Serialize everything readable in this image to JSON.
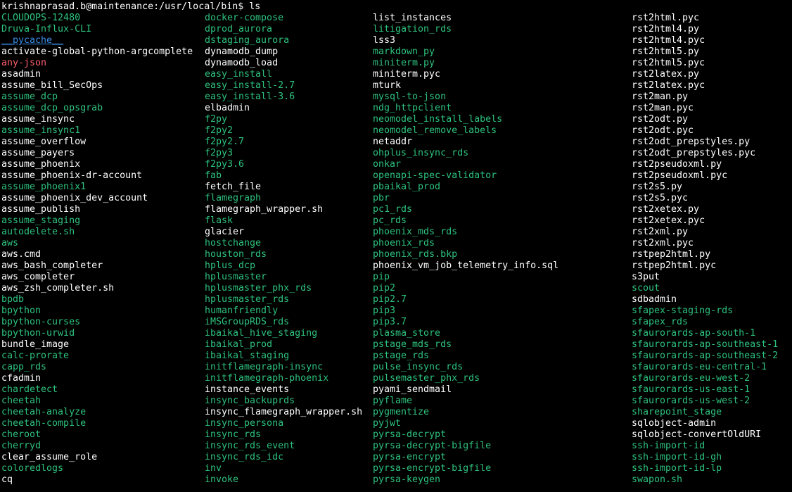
{
  "terminal": {
    "prompt": "krishnaprasad.b@maintenance:/usr/local/bin$ ",
    "command": "ls",
    "colors": {
      "background": "#000000",
      "executable": "#2ec27e",
      "directory": "#3b8eea",
      "regular": "#ffffff",
      "broken_link": "#ff5f6d"
    },
    "columns": [
      [
        {
          "name": "CLOUDOPS-12480",
          "type": "exec"
        },
        {
          "name": "Druva-Influx-CLI",
          "type": "exec"
        },
        {
          "name": "__pycache__",
          "type": "dir"
        },
        {
          "name": "activate-global-python-argcomplete",
          "type": "file"
        },
        {
          "name": "any-json",
          "type": "link"
        },
        {
          "name": "asadmin",
          "type": "file"
        },
        {
          "name": "assume_bill_SecOps",
          "type": "file"
        },
        {
          "name": "assume_dcp",
          "type": "exec"
        },
        {
          "name": "assume_dcp_opsgrab",
          "type": "exec"
        },
        {
          "name": "assume_insync",
          "type": "file"
        },
        {
          "name": "assume_insync1",
          "type": "exec"
        },
        {
          "name": "assume_overflow",
          "type": "file"
        },
        {
          "name": "assume_payers",
          "type": "file"
        },
        {
          "name": "assume_phoenix",
          "type": "file"
        },
        {
          "name": "assume_phoenix-dr-account",
          "type": "file"
        },
        {
          "name": "assume_phoenix1",
          "type": "exec"
        },
        {
          "name": "assume_phoenix_dev_account",
          "type": "file"
        },
        {
          "name": "assume_publish",
          "type": "file"
        },
        {
          "name": "assume_staging",
          "type": "exec"
        },
        {
          "name": "autodelete.sh",
          "type": "exec"
        },
        {
          "name": "aws",
          "type": "exec"
        },
        {
          "name": "aws.cmd",
          "type": "file"
        },
        {
          "name": "aws_bash_completer",
          "type": "file"
        },
        {
          "name": "aws_completer",
          "type": "file"
        },
        {
          "name": "aws_zsh_completer.sh",
          "type": "file"
        },
        {
          "name": "bpdb",
          "type": "exec"
        },
        {
          "name": "bpython",
          "type": "exec"
        },
        {
          "name": "bpython-curses",
          "type": "exec"
        },
        {
          "name": "bpython-urwid",
          "type": "exec"
        },
        {
          "name": "bundle_image",
          "type": "file"
        },
        {
          "name": "calc-prorate",
          "type": "exec"
        },
        {
          "name": "capp_rds",
          "type": "exec"
        },
        {
          "name": "cfadmin",
          "type": "file"
        },
        {
          "name": "chardetect",
          "type": "exec"
        },
        {
          "name": "cheetah",
          "type": "exec"
        },
        {
          "name": "cheetah-analyze",
          "type": "exec"
        },
        {
          "name": "cheetah-compile",
          "type": "exec"
        },
        {
          "name": "cheroot",
          "type": "exec"
        },
        {
          "name": "cherryd",
          "type": "exec"
        },
        {
          "name": "clear_assume_role",
          "type": "file"
        },
        {
          "name": "coloredlogs",
          "type": "exec"
        },
        {
          "name": "cq",
          "type": "file"
        }
      ],
      [
        {
          "name": "docker-compose",
          "type": "exec"
        },
        {
          "name": "dprod_aurora",
          "type": "exec"
        },
        {
          "name": "dstaging_aurora",
          "type": "exec"
        },
        {
          "name": "dynamodb_dump",
          "type": "file"
        },
        {
          "name": "dynamodb_load",
          "type": "file"
        },
        {
          "name": "easy_install",
          "type": "exec"
        },
        {
          "name": "easy_install-2.7",
          "type": "exec"
        },
        {
          "name": "easy_install-3.6",
          "type": "exec"
        },
        {
          "name": "elbadmin",
          "type": "file"
        },
        {
          "name": "f2py",
          "type": "exec"
        },
        {
          "name": "f2py2",
          "type": "exec"
        },
        {
          "name": "f2py2.7",
          "type": "exec"
        },
        {
          "name": "f2py3",
          "type": "exec"
        },
        {
          "name": "f2py3.6",
          "type": "exec"
        },
        {
          "name": "fab",
          "type": "exec"
        },
        {
          "name": "fetch_file",
          "type": "file"
        },
        {
          "name": "flamegraph",
          "type": "exec"
        },
        {
          "name": "flamegraph_wrapper.sh",
          "type": "file"
        },
        {
          "name": "flask",
          "type": "exec"
        },
        {
          "name": "glacier",
          "type": "file"
        },
        {
          "name": "hostchange",
          "type": "exec"
        },
        {
          "name": "houston_rds",
          "type": "exec"
        },
        {
          "name": "hplus_dcp",
          "type": "exec"
        },
        {
          "name": "hplusmaster",
          "type": "exec"
        },
        {
          "name": "hplusmaster_phx_rds",
          "type": "exec"
        },
        {
          "name": "hplusmaster_rds",
          "type": "exec"
        },
        {
          "name": "humanfriendly",
          "type": "exec"
        },
        {
          "name": "iMSGroupRDS_rds",
          "type": "exec"
        },
        {
          "name": "ibaikal_hive_staging",
          "type": "exec"
        },
        {
          "name": "ibaikal_prod",
          "type": "exec"
        },
        {
          "name": "ibaikal_staging",
          "type": "exec"
        },
        {
          "name": "initflamegraph-insync",
          "type": "exec"
        },
        {
          "name": "initflamegraph-phoenix",
          "type": "exec"
        },
        {
          "name": "instance_events",
          "type": "file"
        },
        {
          "name": "insync_backuprds",
          "type": "exec"
        },
        {
          "name": "insync_flamegraph_wrapper.sh",
          "type": "file"
        },
        {
          "name": "insync_persona",
          "type": "exec"
        },
        {
          "name": "insync_rds",
          "type": "exec"
        },
        {
          "name": "insync_rds_event",
          "type": "exec"
        },
        {
          "name": "insync_rds_idc",
          "type": "exec"
        },
        {
          "name": "inv",
          "type": "exec"
        },
        {
          "name": "invoke",
          "type": "exec"
        }
      ],
      [
        {
          "name": "list_instances",
          "type": "file"
        },
        {
          "name": "litigation_rds",
          "type": "exec"
        },
        {
          "name": "lss3",
          "type": "file"
        },
        {
          "name": "markdown_py",
          "type": "exec"
        },
        {
          "name": "miniterm.py",
          "type": "exec"
        },
        {
          "name": "miniterm.pyc",
          "type": "file"
        },
        {
          "name": "mturk",
          "type": "file"
        },
        {
          "name": "mysql-to-json",
          "type": "exec"
        },
        {
          "name": "ndg_httpclient",
          "type": "exec"
        },
        {
          "name": "neomodel_install_labels",
          "type": "exec"
        },
        {
          "name": "neomodel_remove_labels",
          "type": "exec"
        },
        {
          "name": "netaddr",
          "type": "file"
        },
        {
          "name": "ohplus_insync_rds",
          "type": "exec"
        },
        {
          "name": "onkar",
          "type": "exec"
        },
        {
          "name": "openapi-spec-validator",
          "type": "exec"
        },
        {
          "name": "pbaikal_prod",
          "type": "exec"
        },
        {
          "name": "pbr",
          "type": "exec"
        },
        {
          "name": "pc1_rds",
          "type": "exec"
        },
        {
          "name": "pc_rds",
          "type": "exec"
        },
        {
          "name": "phoenix_mds_rds",
          "type": "exec"
        },
        {
          "name": "phoenix_rds",
          "type": "exec"
        },
        {
          "name": "phoenix_rds.bkp",
          "type": "exec"
        },
        {
          "name": "phoenix_vm_job_telemetry_info.sql",
          "type": "file"
        },
        {
          "name": "pip",
          "type": "exec"
        },
        {
          "name": "pip2",
          "type": "exec"
        },
        {
          "name": "pip2.7",
          "type": "exec"
        },
        {
          "name": "pip3",
          "type": "exec"
        },
        {
          "name": "pip3.7",
          "type": "exec"
        },
        {
          "name": "plasma_store",
          "type": "exec"
        },
        {
          "name": "pstage_mds_rds",
          "type": "exec"
        },
        {
          "name": "pstage_rds",
          "type": "exec"
        },
        {
          "name": "pulse_insync_rds",
          "type": "exec"
        },
        {
          "name": "pulsemaster_phx_rds",
          "type": "exec"
        },
        {
          "name": "pyami_sendmail",
          "type": "file"
        },
        {
          "name": "pyflame",
          "type": "exec"
        },
        {
          "name": "pygmentize",
          "type": "exec"
        },
        {
          "name": "pyjwt",
          "type": "exec"
        },
        {
          "name": "pyrsa-decrypt",
          "type": "exec"
        },
        {
          "name": "pyrsa-decrypt-bigfile",
          "type": "exec"
        },
        {
          "name": "pyrsa-encrypt",
          "type": "exec"
        },
        {
          "name": "pyrsa-encrypt-bigfile",
          "type": "exec"
        },
        {
          "name": "pyrsa-keygen",
          "type": "exec"
        }
      ],
      [
        {
          "name": "rst2html.pyc",
          "type": "file"
        },
        {
          "name": "rst2html4.py",
          "type": "file"
        },
        {
          "name": "rst2html4.pyc",
          "type": "file"
        },
        {
          "name": "rst2html5.py",
          "type": "file"
        },
        {
          "name": "rst2html5.pyc",
          "type": "file"
        },
        {
          "name": "rst2latex.py",
          "type": "file"
        },
        {
          "name": "rst2latex.pyc",
          "type": "file"
        },
        {
          "name": "rst2man.py",
          "type": "file"
        },
        {
          "name": "rst2man.pyc",
          "type": "file"
        },
        {
          "name": "rst2odt.py",
          "type": "file"
        },
        {
          "name": "rst2odt.pyc",
          "type": "file"
        },
        {
          "name": "rst2odt_prepstyles.py",
          "type": "file"
        },
        {
          "name": "rst2odt_prepstyles.pyc",
          "type": "file"
        },
        {
          "name": "rst2pseudoxml.py",
          "type": "file"
        },
        {
          "name": "rst2pseudoxml.pyc",
          "type": "file"
        },
        {
          "name": "rst2s5.py",
          "type": "file"
        },
        {
          "name": "rst2s5.pyc",
          "type": "file"
        },
        {
          "name": "rst2xetex.py",
          "type": "file"
        },
        {
          "name": "rst2xetex.pyc",
          "type": "file"
        },
        {
          "name": "rst2xml.py",
          "type": "file"
        },
        {
          "name": "rst2xml.pyc",
          "type": "file"
        },
        {
          "name": "rstpep2html.py",
          "type": "file"
        },
        {
          "name": "rstpep2html.pyc",
          "type": "file"
        },
        {
          "name": "s3put",
          "type": "file"
        },
        {
          "name": "scout",
          "type": "exec"
        },
        {
          "name": "sdbadmin",
          "type": "file"
        },
        {
          "name": "sfapex-staging-rds",
          "type": "exec"
        },
        {
          "name": "sfapex_rds",
          "type": "exec"
        },
        {
          "name": "sfaurorards-ap-south-1",
          "type": "exec"
        },
        {
          "name": "sfaurorards-ap-southeast-1",
          "type": "exec"
        },
        {
          "name": "sfaurorards-ap-southeast-2",
          "type": "exec"
        },
        {
          "name": "sfaurorards-eu-central-1",
          "type": "exec"
        },
        {
          "name": "sfaurorards-eu-west-2",
          "type": "exec"
        },
        {
          "name": "sfaurorards-us-east-1",
          "type": "exec"
        },
        {
          "name": "sfaurorards-us-west-2",
          "type": "exec"
        },
        {
          "name": "sharepoint_stage",
          "type": "exec"
        },
        {
          "name": "sqlobject-admin",
          "type": "file"
        },
        {
          "name": "sqlobject-convertOldURI",
          "type": "file"
        },
        {
          "name": "ssh-import-id",
          "type": "exec"
        },
        {
          "name": "ssh-import-id-gh",
          "type": "exec"
        },
        {
          "name": "ssh-import-id-lp",
          "type": "exec"
        },
        {
          "name": "swapon.sh",
          "type": "exec"
        }
      ]
    ]
  }
}
